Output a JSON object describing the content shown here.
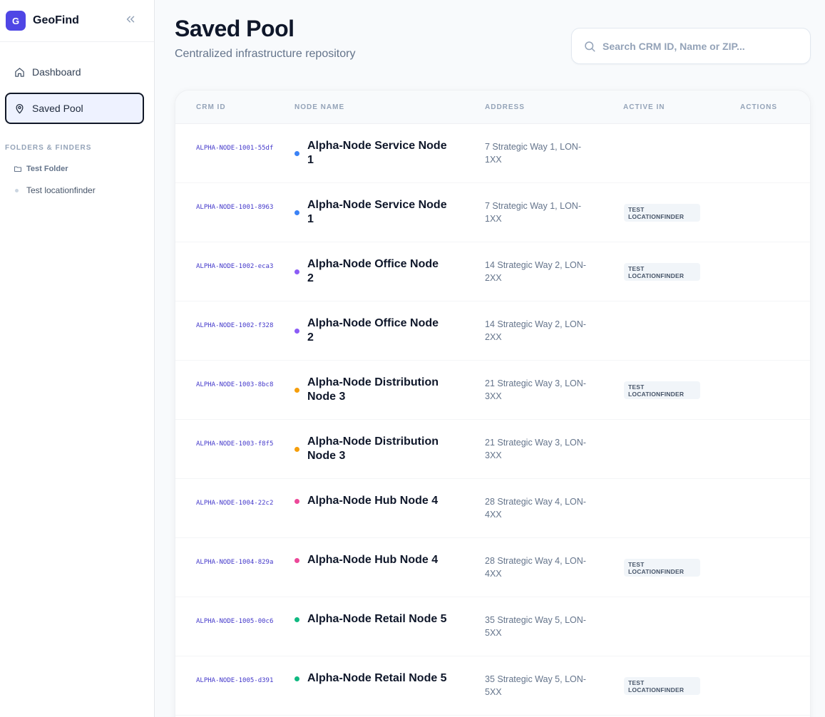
{
  "brand": {
    "logo_letter": "G",
    "name": "GeoFind"
  },
  "sidebar": {
    "nav": [
      {
        "label": "Dashboard",
        "icon": "home-icon",
        "active": false
      },
      {
        "label": "Saved Pool",
        "icon": "map-pin-icon",
        "active": true
      }
    ],
    "section_label": "FOLDERS & FINDERS",
    "folder": {
      "label": "Test Folder",
      "icon": "folder-icon"
    },
    "finder": {
      "label": "Test locationfinder"
    }
  },
  "header": {
    "title": "Saved Pool",
    "subtitle": "Centralized infrastructure repository"
  },
  "search": {
    "placeholder": "Search CRM ID, Name or ZIP...",
    "value": ""
  },
  "table": {
    "columns": [
      "CRM ID",
      "NODE NAME",
      "ADDRESS",
      "ACTIVE IN",
      "ACTIONS"
    ],
    "rows": [
      {
        "crm_id": "ALPHA-NODE-1001-55df",
        "name": "Alpha-Node Service Node 1",
        "address": "7 Strategic Way 1, LON-1XX",
        "active_in": "",
        "color": "#3b82f6"
      },
      {
        "crm_id": "ALPHA-NODE-1001-8963",
        "name": "Alpha-Node Service Node 1",
        "address": "7 Strategic Way 1, LON-1XX",
        "active_in": "TEST LOCATIONFINDER",
        "color": "#3b82f6"
      },
      {
        "crm_id": "ALPHA-NODE-1002-eca3",
        "name": "Alpha-Node Office Node 2",
        "address": "14 Strategic Way 2, LON-2XX",
        "active_in": "TEST LOCATIONFINDER",
        "color": "#8b5cf6"
      },
      {
        "crm_id": "ALPHA-NODE-1002-f328",
        "name": "Alpha-Node Office Node 2",
        "address": "14 Strategic Way 2, LON-2XX",
        "active_in": "",
        "color": "#8b5cf6"
      },
      {
        "crm_id": "ALPHA-NODE-1003-8bc8",
        "name": "Alpha-Node Distribution Node 3",
        "address": "21 Strategic Way 3, LON-3XX",
        "active_in": "TEST LOCATIONFINDER",
        "color": "#f59e0b"
      },
      {
        "crm_id": "ALPHA-NODE-1003-f8f5",
        "name": "Alpha-Node Distribution Node 3",
        "address": "21 Strategic Way 3, LON-3XX",
        "active_in": "",
        "color": "#f59e0b"
      },
      {
        "crm_id": "ALPHA-NODE-1004-22c2",
        "name": "Alpha-Node Hub Node 4",
        "address": "28 Strategic Way 4, LON-4XX",
        "active_in": "",
        "color": "#ec4899"
      },
      {
        "crm_id": "ALPHA-NODE-1004-829a",
        "name": "Alpha-Node Hub Node 4",
        "address": "28 Strategic Way 4, LON-4XX",
        "active_in": "TEST LOCATIONFINDER",
        "color": "#ec4899"
      },
      {
        "crm_id": "ALPHA-NODE-1005-00c6",
        "name": "Alpha-Node Retail Node 5",
        "address": "35 Strategic Way 5, LON-5XX",
        "active_in": "",
        "color": "#10b981"
      },
      {
        "crm_id": "ALPHA-NODE-1005-d391",
        "name": "Alpha-Node Retail Node 5",
        "address": "35 Strategic Way 5, LON-5XX",
        "active_in": "TEST LOCATIONFINDER",
        "color": "#10b981"
      }
    ]
  },
  "colors": {
    "accent": "#4f46e5",
    "crm_id_text": "#4338ca"
  }
}
